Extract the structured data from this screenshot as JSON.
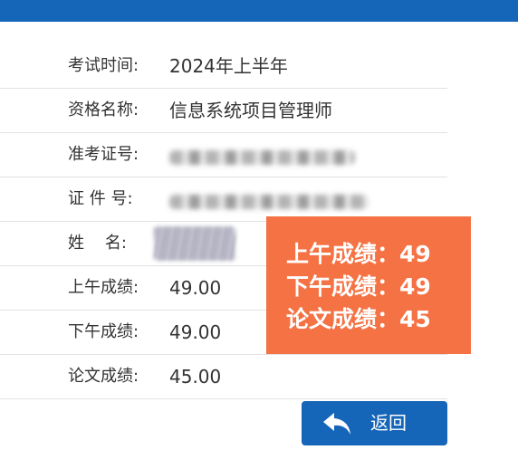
{
  "rows": [
    {
      "label": "考试时间:",
      "value": "2024年上半年"
    },
    {
      "label": "资格名称:",
      "value": "信息系统项目管理师"
    },
    {
      "label": "准考证号:",
      "value": ""
    },
    {
      "label": "证 件 号:",
      "value": ""
    },
    {
      "label": "姓    名:",
      "value": ""
    },
    {
      "label": "上午成绩:",
      "value": "49.00"
    },
    {
      "label": "下午成绩:",
      "value": "49.00"
    },
    {
      "label": "论文成绩:",
      "value": "45.00"
    }
  ],
  "score_box": {
    "line1": "上午成绩：49",
    "line2": "下午成绩：49",
    "line3": "论文成绩：45",
    "color": "#f47244"
  },
  "back_button": {
    "label": "返回",
    "icon": "back-arrow-icon",
    "color": "#1565b8"
  },
  "colors": {
    "topbar": "#1565b8",
    "text": "#333333",
    "divider": "#e2e2e2"
  }
}
